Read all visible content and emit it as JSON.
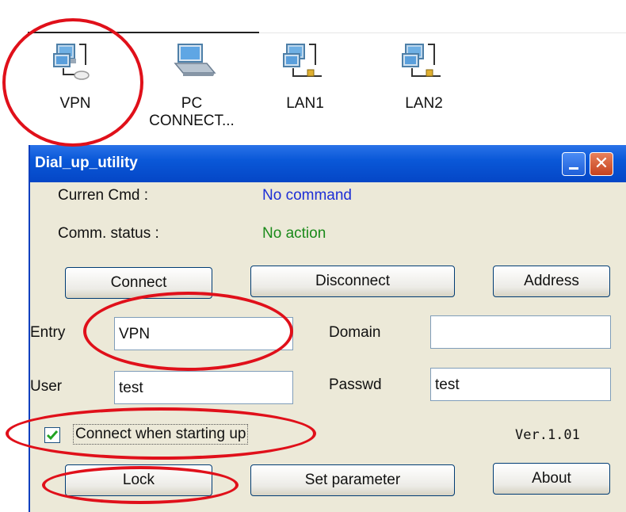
{
  "desktop": {
    "icons": [
      {
        "label": "VPN",
        "icon": "network-connection-icon"
      },
      {
        "label": "PC\nCONNECT...",
        "icon": "direct-connection-icon"
      },
      {
        "label": "LAN1",
        "icon": "lan-connection-icon"
      },
      {
        "label": "LAN2",
        "icon": "lan-connection-icon"
      }
    ]
  },
  "window": {
    "title": "Dial_up_utility",
    "close_glyph": "✕",
    "status": {
      "cmd_label": "Curren Cmd :",
      "cmd_value": "No command",
      "comm_label": "Comm. status :",
      "comm_value": "No action"
    },
    "buttons": {
      "connect": "Connect",
      "disconnect": "Disconnect",
      "address": "Address",
      "lock": "Lock",
      "set_parameter": "Set parameter",
      "about": "About"
    },
    "fields": {
      "entry_label": "Entry",
      "entry_value": "VPN",
      "domain_label": "Domain",
      "domain_value": "",
      "user_label": "User",
      "user_value": "test",
      "passwd_label": "Passwd",
      "passwd_value": "test"
    },
    "checkbox": {
      "label": "Connect when starting up",
      "checked": true
    },
    "version": "Ver.1.01"
  },
  "colors": {
    "titlebar": "#0a58d8",
    "cmd_value": "#1c2ed6",
    "status_value": "#1a8a1a",
    "annotation": "#e0101a",
    "window_bg": "#ece9d8"
  }
}
